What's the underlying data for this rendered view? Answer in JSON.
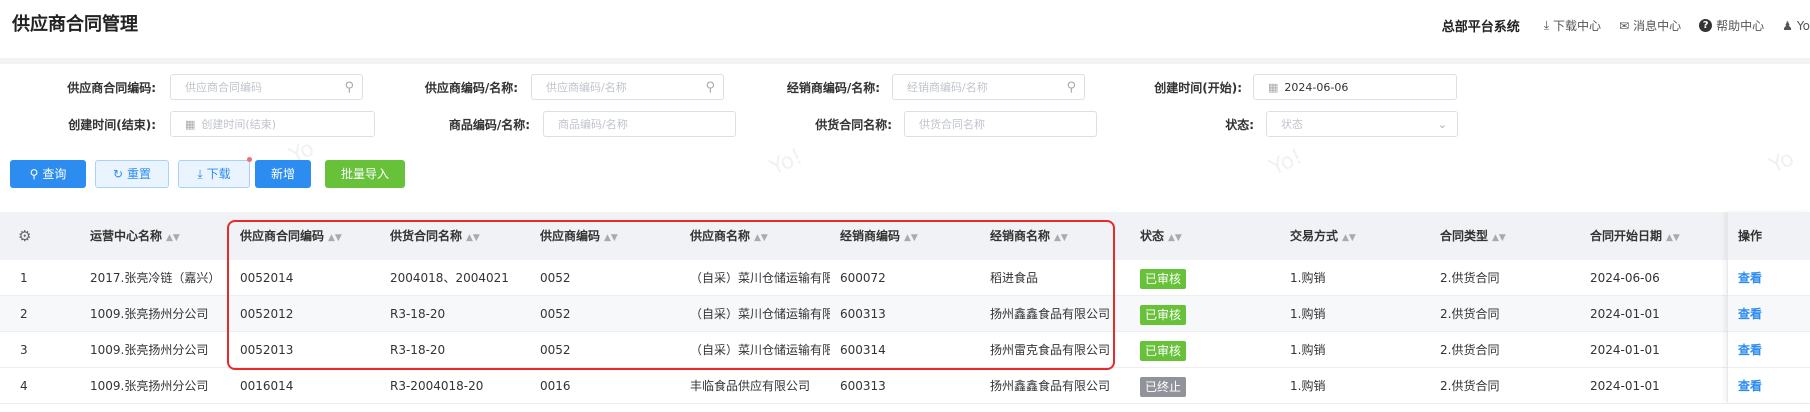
{
  "header": {
    "title": "供应商合同管理",
    "system_name": "总部平台系统",
    "links": [
      {
        "icon": "download-icon",
        "glyph": "⤓",
        "label": "下载中心"
      },
      {
        "icon": "mail-icon",
        "glyph": "✉",
        "label": "消息中心"
      },
      {
        "icon": "help-icon",
        "glyph": "?",
        "label": "帮助中心"
      },
      {
        "icon": "user-icon",
        "glyph": "♟",
        "label": "Yo"
      }
    ]
  },
  "filters": {
    "contract_code": {
      "label": "供应商合同编码:",
      "placeholder": "供应商合同编码"
    },
    "supplier": {
      "label": "供应商编码/名称:",
      "placeholder": "供应商编码/名称"
    },
    "distributor": {
      "label": "经销商编码/名称:",
      "placeholder": "经销商编码/名称"
    },
    "created_start": {
      "label": "创建时间(开始):",
      "value": "2024-06-06"
    },
    "created_end": {
      "label": "创建时间(结束):",
      "placeholder": "创建时间(结束)"
    },
    "product": {
      "label": "商品编码/名称:",
      "placeholder": "商品编码/名称"
    },
    "supply_contract_name": {
      "label": "供货合同名称:",
      "placeholder": "供货合同名称"
    },
    "status": {
      "label": "状态:",
      "placeholder": "状态"
    }
  },
  "toolbar": {
    "query": "查询",
    "reset": "重置",
    "download": "下载",
    "add": "新增",
    "batch_import": "批量导入"
  },
  "table": {
    "columns": [
      "运营中心名称",
      "供应商合同编码",
      "供货合同名称",
      "供应商编码",
      "供应商名称",
      "经销商编码",
      "经销商名称",
      "状态",
      "交易方式",
      "合同类型",
      "合同开始日期",
      "操作"
    ],
    "rows": [
      {
        "no": "1",
        "center": "2017.张亮冷链（嘉兴）",
        "contract_code": "0052014",
        "supply_name": "2004018、2004021",
        "supplier_code": "0052",
        "supplier_name": "（自采）菜川仓储运输有限",
        "dist_code": "600072",
        "dist_name": "稻进食品",
        "status": "已审核",
        "status_color": "#67c23a",
        "trade": "1.购销",
        "type": "2.供货合同",
        "start": "2024-06-06",
        "op": "查看"
      },
      {
        "no": "2",
        "center": "1009.张亮扬州分公司",
        "contract_code": "0052012",
        "supply_name": "R3-18-20",
        "supplier_code": "0052",
        "supplier_name": "（自采）菜川仓储运输有限",
        "dist_code": "600313",
        "dist_name": "扬州鑫鑫食品有限公司",
        "status": "已审核",
        "status_color": "#67c23a",
        "trade": "1.购销",
        "type": "2.供货合同",
        "start": "2024-01-01",
        "op": "查看"
      },
      {
        "no": "3",
        "center": "1009.张亮扬州分公司",
        "contract_code": "0052013",
        "supply_name": "R3-18-20",
        "supplier_code": "0052",
        "supplier_name": "（自采）菜川仓储运输有限",
        "dist_code": "600314",
        "dist_name": "扬州雷克食品有限公司",
        "status": "已审核",
        "status_color": "#67c23a",
        "trade": "1.购销",
        "type": "2.供货合同",
        "start": "2024-01-01",
        "op": "查看"
      },
      {
        "no": "4",
        "center": "1009.张亮扬州分公司",
        "contract_code": "0016014",
        "supply_name": "R3-2004018-20",
        "supplier_code": "0016",
        "supplier_name": "丰临食品供应有限公司",
        "dist_code": "600313",
        "dist_name": "扬州鑫鑫食品有限公司",
        "status": "已终止",
        "status_color": "#909399",
        "trade": "1.购销",
        "type": "2.供货合同",
        "start": "2024-01-01",
        "op": "查看"
      }
    ]
  }
}
